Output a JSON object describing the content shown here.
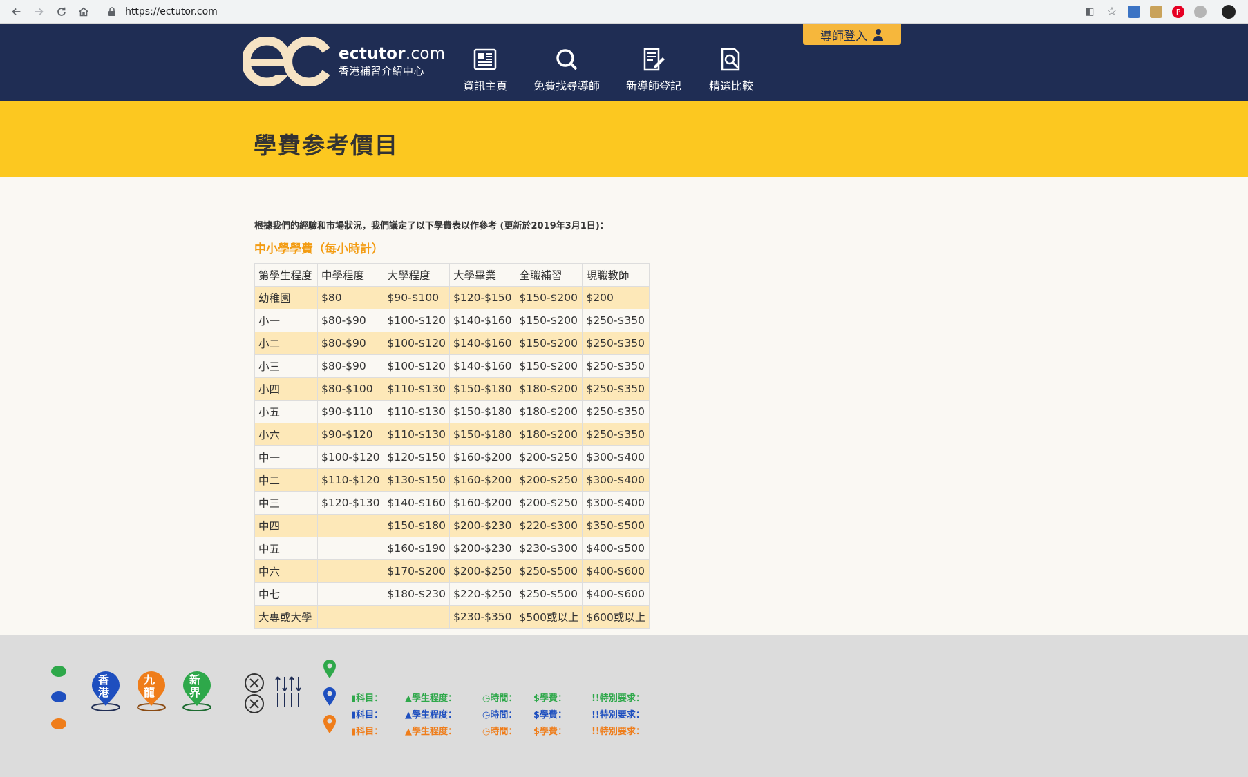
{
  "browser": {
    "url": "https://ectutor.com"
  },
  "header": {
    "logo_domain_main": "ectutor",
    "logo_domain_tld": ".com",
    "logo_subtitle": "香港補習介紹中心",
    "login_label": "導師登入",
    "nav": [
      {
        "label": "資訊主頁",
        "icon": "newspaper-icon",
        "active": true
      },
      {
        "label": "免費找尋導師",
        "icon": "search-icon",
        "active": false
      },
      {
        "label": "新導師登記",
        "icon": "register-icon",
        "active": false
      },
      {
        "label": "精選比較",
        "icon": "compare-icon",
        "active": false
      }
    ]
  },
  "page": {
    "title": "學費参考價目",
    "intro": "根據我們的經驗和市場狀況，我們議定了以下學費表以作參考 (更新於2019年3月1日)：",
    "section_title": "中小學學費（每小時計）"
  },
  "table": {
    "headers": [
      "第學生程度",
      "中學程度",
      "大學程度",
      "大學畢業",
      "全職補習",
      "現職教師"
    ],
    "rows": [
      [
        "幼稚園",
        "$80",
        "$90-$100",
        "$120-$150",
        "$150-$200",
        "$200"
      ],
      [
        "小一",
        "$80-$90",
        "$100-$120",
        "$140-$160",
        "$150-$200",
        "$250-$350"
      ],
      [
        "小二",
        "$80-$90",
        "$100-$120",
        "$140-$160",
        "$150-$200",
        "$250-$350"
      ],
      [
        "小三",
        "$80-$90",
        "$100-$120",
        "$140-$160",
        "$150-$200",
        "$250-$350"
      ],
      [
        "小四",
        "$80-$100",
        "$110-$130",
        "$150-$180",
        "$180-$200",
        "$250-$350"
      ],
      [
        "小五",
        "$90-$110",
        "$110-$130",
        "$150-$180",
        "$180-$200",
        "$250-$350"
      ],
      [
        "小六",
        "$90-$120",
        "$110-$130",
        "$150-$180",
        "$180-$200",
        "$250-$350"
      ],
      [
        "中一",
        "$100-$120",
        "$120-$150",
        "$160-$200",
        "$200-$250",
        "$300-$400"
      ],
      [
        "中二",
        "$110-$120",
        "$130-$150",
        "$160-$200",
        "$200-$250",
        "$300-$400"
      ],
      [
        "中三",
        "$120-$130",
        "$140-$160",
        "$160-$200",
        "$200-$250",
        "$300-$400"
      ],
      [
        "中四",
        "",
        "$150-$180",
        "$200-$230",
        "$220-$300",
        "$350-$500"
      ],
      [
        "中五",
        "",
        "$160-$190",
        "$200-$230",
        "$230-$300",
        "$400-$500"
      ],
      [
        "中六",
        "",
        "$170-$200",
        "$200-$250",
        "$250-$500",
        "$400-$600"
      ],
      [
        "中七",
        "",
        "$180-$230",
        "$220-$250",
        "$250-$500",
        "$400-$600"
      ],
      [
        "大專或大學",
        "",
        "",
        "$230-$350",
        "$500或以上",
        "$600或以上"
      ]
    ]
  },
  "footer": {
    "pins": [
      {
        "label": "香港",
        "color": "#1e4fbf"
      },
      {
        "label": "九龍",
        "color": "#ef7d1a"
      },
      {
        "label": "新界",
        "color": "#2ea84a"
      }
    ],
    "legend": {
      "subject": "科目：",
      "level": "學生程度：",
      "time": "時間：",
      "fee": "學費：",
      "special": "特別要求："
    },
    "colors": {
      "green": "#2ea84a",
      "blue": "#1e4fbf",
      "orange": "#ef7d1a"
    }
  }
}
